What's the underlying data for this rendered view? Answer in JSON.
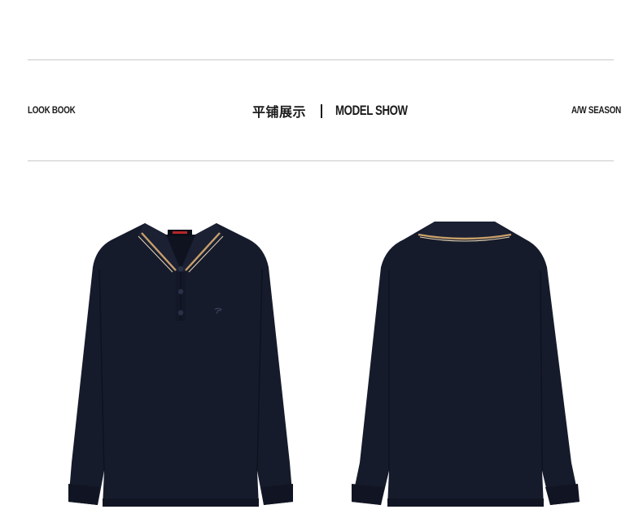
{
  "header": {
    "left_label": "LOOK BOOK",
    "center_cn_title": "平铺展示",
    "center_en_title": "MODEL SHOW",
    "right_label": "A/W SEASON"
  },
  "colors": {
    "shirt_body": "#161b2c",
    "shirt_shadow": "#0f1320",
    "collar_tipping": "#c9a06a",
    "rule_line": "#c9c9c9",
    "brand_tag": "#b5262a"
  },
  "products": [
    {
      "view": "front",
      "icon": "polo-shirt-front-image"
    },
    {
      "view": "back",
      "icon": "polo-shirt-back-image"
    }
  ]
}
